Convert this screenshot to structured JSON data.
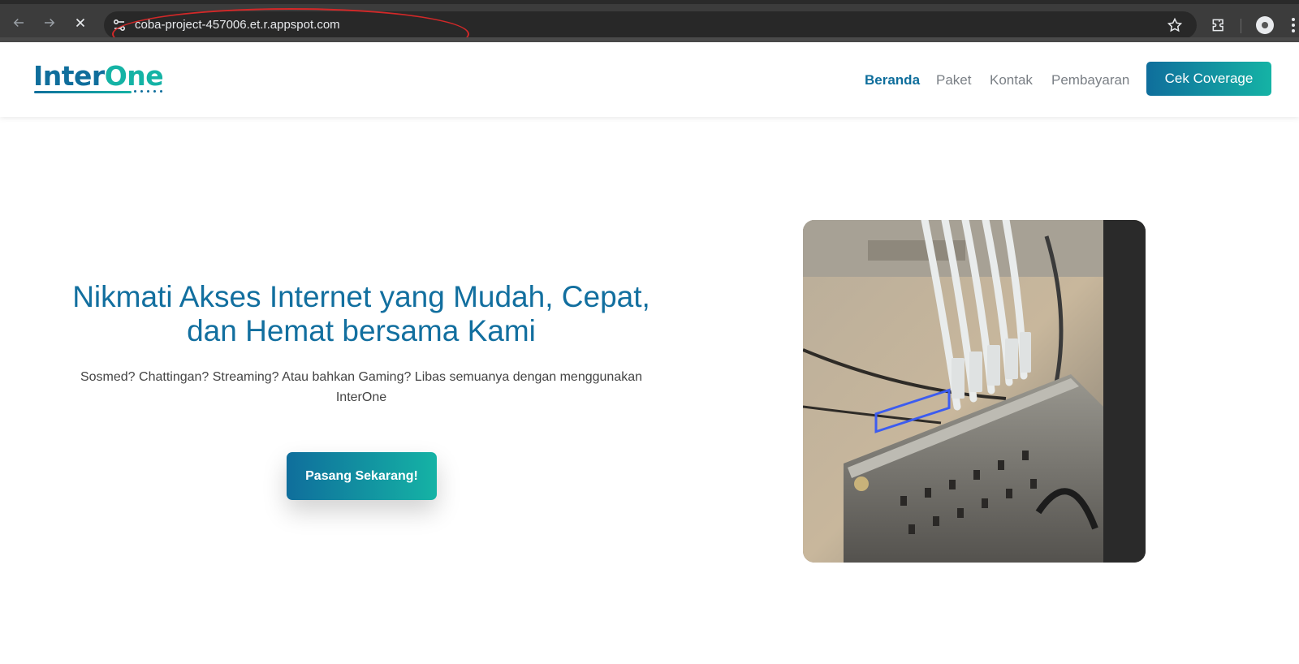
{
  "browser": {
    "url": "coba-project-457006.et.r.appspot.com"
  },
  "site": {
    "logo": {
      "part1": "Inter",
      "part2": "One"
    },
    "nav": {
      "items": [
        {
          "label": "Beranda",
          "active": true
        },
        {
          "label": "Paket",
          "active": false
        },
        {
          "label": "Kontak",
          "active": false
        },
        {
          "label": "Pembayaran",
          "active": false
        }
      ],
      "cta_label": "Cek Coverage"
    }
  },
  "hero": {
    "title_line1": "Nikmati Akses Internet yang Mudah, Cepat,",
    "title_line2": "dan Hemat bersama Kami",
    "subtitle_line1": "Sosmed? Chattingan? Streaming? Atau bahkan Gaming? Libas semuanya dengan menggunakan",
    "subtitle_line2": "InterOne",
    "button_label": "Pasang Sekarang!"
  },
  "colors": {
    "brand_primary": "#0f6e9c",
    "brand_secondary": "#15b3a5",
    "annotation": "#d32828"
  }
}
